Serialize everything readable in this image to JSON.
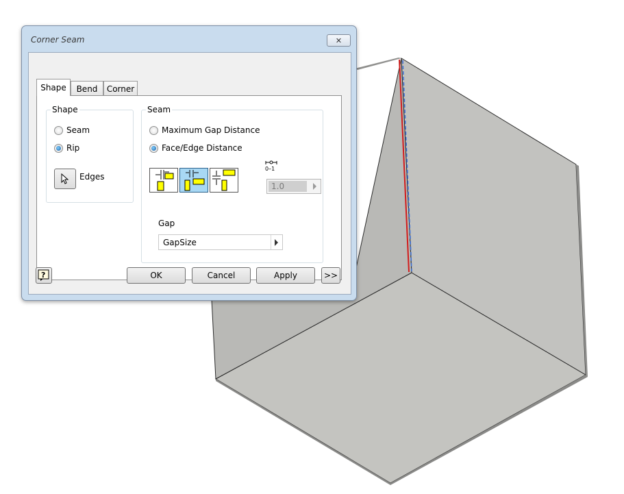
{
  "dialog": {
    "title": "Corner Seam",
    "close_icon": "close-icon",
    "tabs": [
      {
        "label": "Shape",
        "active": true
      },
      {
        "label": "Bend",
        "active": false
      },
      {
        "label": "Corner",
        "active": false
      }
    ],
    "shape_group": {
      "label": "Shape",
      "options": [
        {
          "label": "Seam",
          "selected": false
        },
        {
          "label": "Rip",
          "selected": true
        }
      ],
      "edges_label": "Edges",
      "edges_icon": "arrow-cursor-icon"
    },
    "seam_group": {
      "label": "Seam",
      "options": [
        {
          "label": "Maximum Gap Distance",
          "selected": false
        },
        {
          "label": "Face/Edge Distance",
          "selected": true
        }
      ],
      "shape_buttons": [
        {
          "icon": "seam-shape-overlap-1-icon",
          "selected": false
        },
        {
          "icon": "seam-shape-butt-icon",
          "selected": true
        },
        {
          "icon": "seam-shape-overlap-2-icon",
          "selected": false
        }
      ],
      "ratio_icon": "overlap-ratio-icon",
      "ratio_value": "1.0",
      "gap_label": "Gap",
      "gap_value": "GapSize"
    },
    "buttons": {
      "help_icon": "help-icon",
      "ok": "OK",
      "cancel": "Cancel",
      "apply": "Apply",
      "more": ">>"
    }
  }
}
